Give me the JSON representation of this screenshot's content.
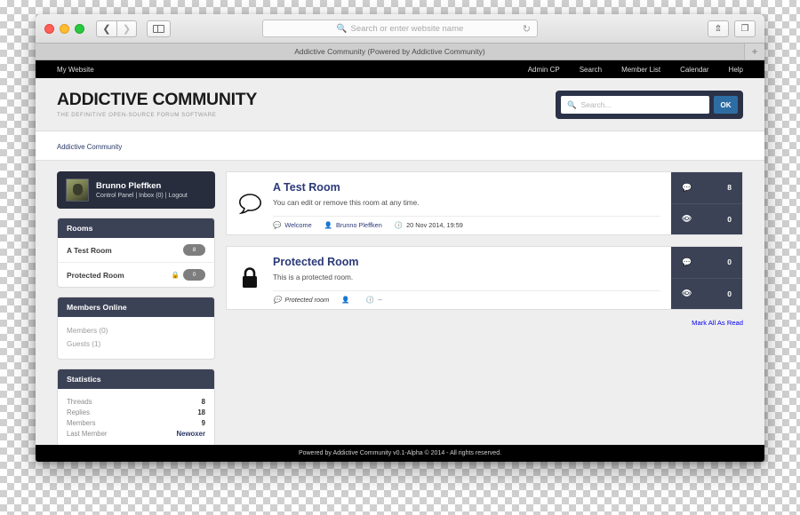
{
  "browser": {
    "address_placeholder": "Search or enter website name",
    "reload_icon": "reload-icon",
    "back_icon": "chevron-left-icon",
    "forward_icon": "chevron-right-icon",
    "sidebar_icon": "sidebar-toggle-icon",
    "share_icon": "share-icon",
    "tabs_icon": "show-tabs-icon",
    "tab_title": "Addictive Community (Powered by Addictive Community)",
    "new_tab_label": "+"
  },
  "topnav": {
    "brand": "My Website",
    "links": [
      "Admin CP",
      "Search",
      "Member List",
      "Calendar",
      "Help"
    ]
  },
  "header": {
    "logo_title": "ADDICTIVE COMMUNITY",
    "logo_subtitle": "THE DEFINITIVE OPEN-SOURCE FORUM SOFTWARE",
    "search_placeholder": "Search...",
    "search_value": "",
    "search_icon": "search-icon",
    "ok_label": "OK"
  },
  "breadcrumb": {
    "items": [
      "Addictive Community"
    ]
  },
  "sidebar": {
    "user": {
      "name": "Brunno Pleffken",
      "links": "Control Panel | Inbox (0) | Logout",
      "avatar": "user-avatar"
    },
    "rooms_panel": {
      "title": "Rooms",
      "rooms": [
        {
          "name": "A Test Room",
          "badge": "8",
          "locked": false
        },
        {
          "name": "Protected Room",
          "badge": "0",
          "locked": true,
          "lock_icon": "lock-icon"
        }
      ]
    },
    "members_panel": {
      "title": "Members Online",
      "lines": [
        "Members (0)",
        "Guests (1)"
      ]
    },
    "statistics_panel": {
      "title": "Statistics",
      "rows": [
        {
          "label": "Threads",
          "value": "8",
          "link": false
        },
        {
          "label": "Replies",
          "value": "18",
          "link": false
        },
        {
          "label": "Members",
          "value": "9",
          "link": false
        },
        {
          "label": "Last Member",
          "value": "Newoxer",
          "link": true
        }
      ]
    }
  },
  "main": {
    "rooms": [
      {
        "icon": "speech-bubble-icon",
        "title": "A Test Room",
        "description": "You can edit or remove this room at any time.",
        "meta": {
          "category_icon": "comment-icon",
          "category": "Welcome",
          "author_icon": "user-icon",
          "author": "Brunno Pleffken",
          "time_icon": "clock-icon",
          "time": "20 Nov 2014, 19:59"
        },
        "stats": [
          {
            "icon": "comments-icon",
            "value": "8"
          },
          {
            "icon": "eye-icon",
            "value": "0"
          }
        ]
      },
      {
        "icon": "lock-icon",
        "title": "Protected Room",
        "description": "This is a protected room.",
        "meta": {
          "category_icon": "comment-icon",
          "category": "Protected room",
          "author_icon": "user-icon",
          "author": "",
          "time_icon": "clock-icon",
          "time": "---"
        },
        "stats": [
          {
            "icon": "comments-icon",
            "value": "0"
          },
          {
            "icon": "eye-icon",
            "value": "0"
          }
        ]
      }
    ],
    "mark_all_read": "Mark All As Read"
  },
  "footer": {
    "text": "Powered by Addictive Community v0.1-Alpha © 2014 - All rights reserved."
  },
  "colors": {
    "panel_header": "#3b4256",
    "user_panel": "#272d3d",
    "search_wrap": "#2b3247",
    "ok_button": "#2e6da4",
    "link": "#2b3a78"
  }
}
